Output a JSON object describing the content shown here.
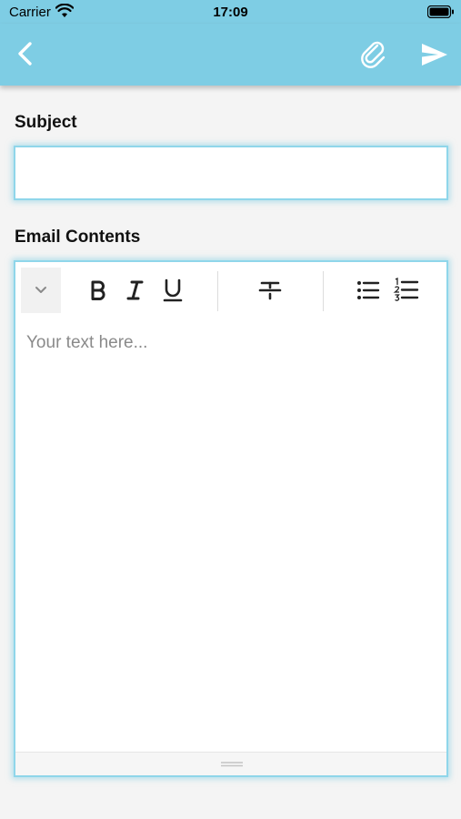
{
  "status": {
    "carrier": "Carrier",
    "time": "17:09"
  },
  "navbar": {
    "back_icon": "chevron-left-icon",
    "attach_icon": "paperclip-icon",
    "send_icon": "send-icon",
    "color": "#7ecde4"
  },
  "form": {
    "subject_label": "Subject",
    "subject_value": "",
    "contents_label": "Email Contents",
    "contents_placeholder": "Your text here..."
  },
  "toolbar": {
    "items": [
      "chevron-down-icon",
      "bold-icon",
      "italic-icon",
      "underline-icon",
      "strikethrough-icon",
      "bullet-list-icon",
      "numbered-list-icon"
    ]
  },
  "theme": {
    "accent": "#7ecde4",
    "focus_border": "#8fd6ea",
    "background": "#f4f4f4"
  }
}
